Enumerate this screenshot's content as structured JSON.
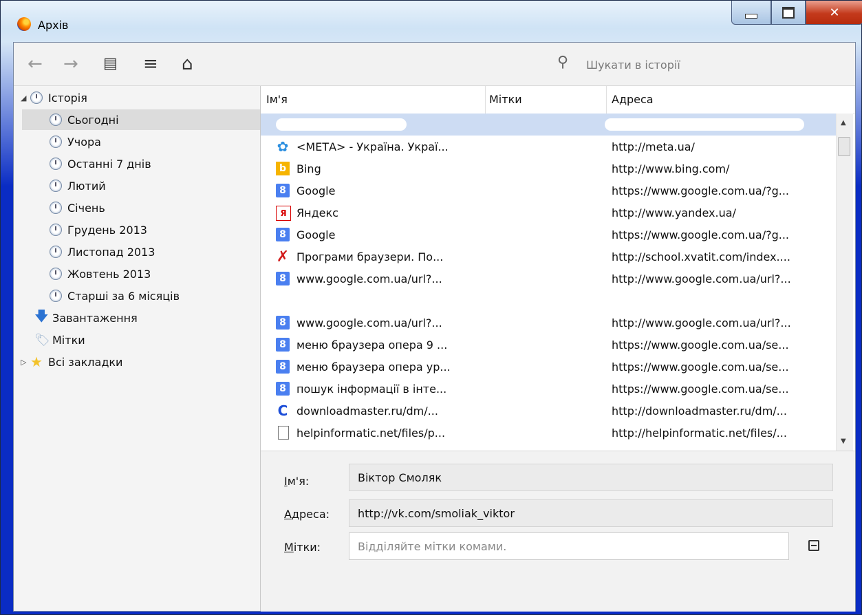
{
  "window": {
    "title": "Архів"
  },
  "toolbar": {
    "back_icon": "←",
    "forward_icon": "→",
    "organize_icon": "▤",
    "views_icon": "≡",
    "import_icon": "⌂",
    "search_icon": "🔍",
    "search_placeholder": "Шукати в історії"
  },
  "sidebar": {
    "history_label": "Історія",
    "items": [
      {
        "label": "Сьогодні"
      },
      {
        "label": "Учора"
      },
      {
        "label": "Останні 7 днів"
      },
      {
        "label": "Лютий"
      },
      {
        "label": "Січень"
      },
      {
        "label": "Грудень 2013"
      },
      {
        "label": "Листопад 2013"
      },
      {
        "label": "Жовтень 2013"
      },
      {
        "label": "Старші за 6 місяців"
      }
    ],
    "downloads_label": "Завантаження",
    "tags_label": "Мітки",
    "bookmarks_label": "Всі закладки"
  },
  "table": {
    "headers": {
      "name": "Ім'я",
      "tags": "Мітки",
      "address": "Адреса"
    },
    "rows": [
      {
        "name": "<МЕТА> - Україна. Украї...",
        "url": "http://meta.ua/",
        "icon": "meta"
      },
      {
        "name": "Bing",
        "url": "http://www.bing.com/",
        "icon": "bing"
      },
      {
        "name": "Google",
        "url": "https://www.google.com.ua/?g...",
        "icon": "google"
      },
      {
        "name": "Яндекс",
        "url": "http://www.yandex.ua/",
        "icon": "yandex"
      },
      {
        "name": "Google",
        "url": "https://www.google.com.ua/?g...",
        "icon": "google"
      },
      {
        "name": "Програми браузери. По...",
        "url": "http://school.xvatit.com/index....",
        "icon": "xvatit"
      },
      {
        "name": "www.google.com.ua/url?...",
        "url": "http://www.google.com.ua/url?...",
        "icon": "google"
      },
      {
        "name": "www.google.com.ua/url?...",
        "url": "http://www.google.com.ua/url?...",
        "icon": "google"
      },
      {
        "name": "меню браузера опера 9 ...",
        "url": "https://www.google.com.ua/se...",
        "icon": "google"
      },
      {
        "name": "меню браузера опера ур...",
        "url": "https://www.google.com.ua/se...",
        "icon": "google"
      },
      {
        "name": "пошук інформації в інте...",
        "url": "https://www.google.com.ua/se...",
        "icon": "google"
      },
      {
        "name": "downloadmaster.ru/dm/...",
        "url": "http://downloadmaster.ru/dm/...",
        "icon": "downloadmaster"
      },
      {
        "name": "helpinformatic.net/files/p...",
        "url": "http://helpinformatic.net/files/...",
        "icon": "file"
      }
    ]
  },
  "details": {
    "name_label_key": "І",
    "name_label_rest": "м'я:",
    "name_value": "Віктор Смоляк",
    "address_label_key": "А",
    "address_label_rest": "дреса:",
    "address_value": "http://vk.com/smoliak_viktor",
    "tags_label_key": "М",
    "tags_label_rest": "ітки:",
    "tags_placeholder": "Відділяйте мітки комами."
  },
  "icons": {
    "google": "8",
    "bing": "b",
    "yandex": "Я",
    "meta": "✿",
    "xvatit": "✗",
    "downloadmaster": "C"
  }
}
